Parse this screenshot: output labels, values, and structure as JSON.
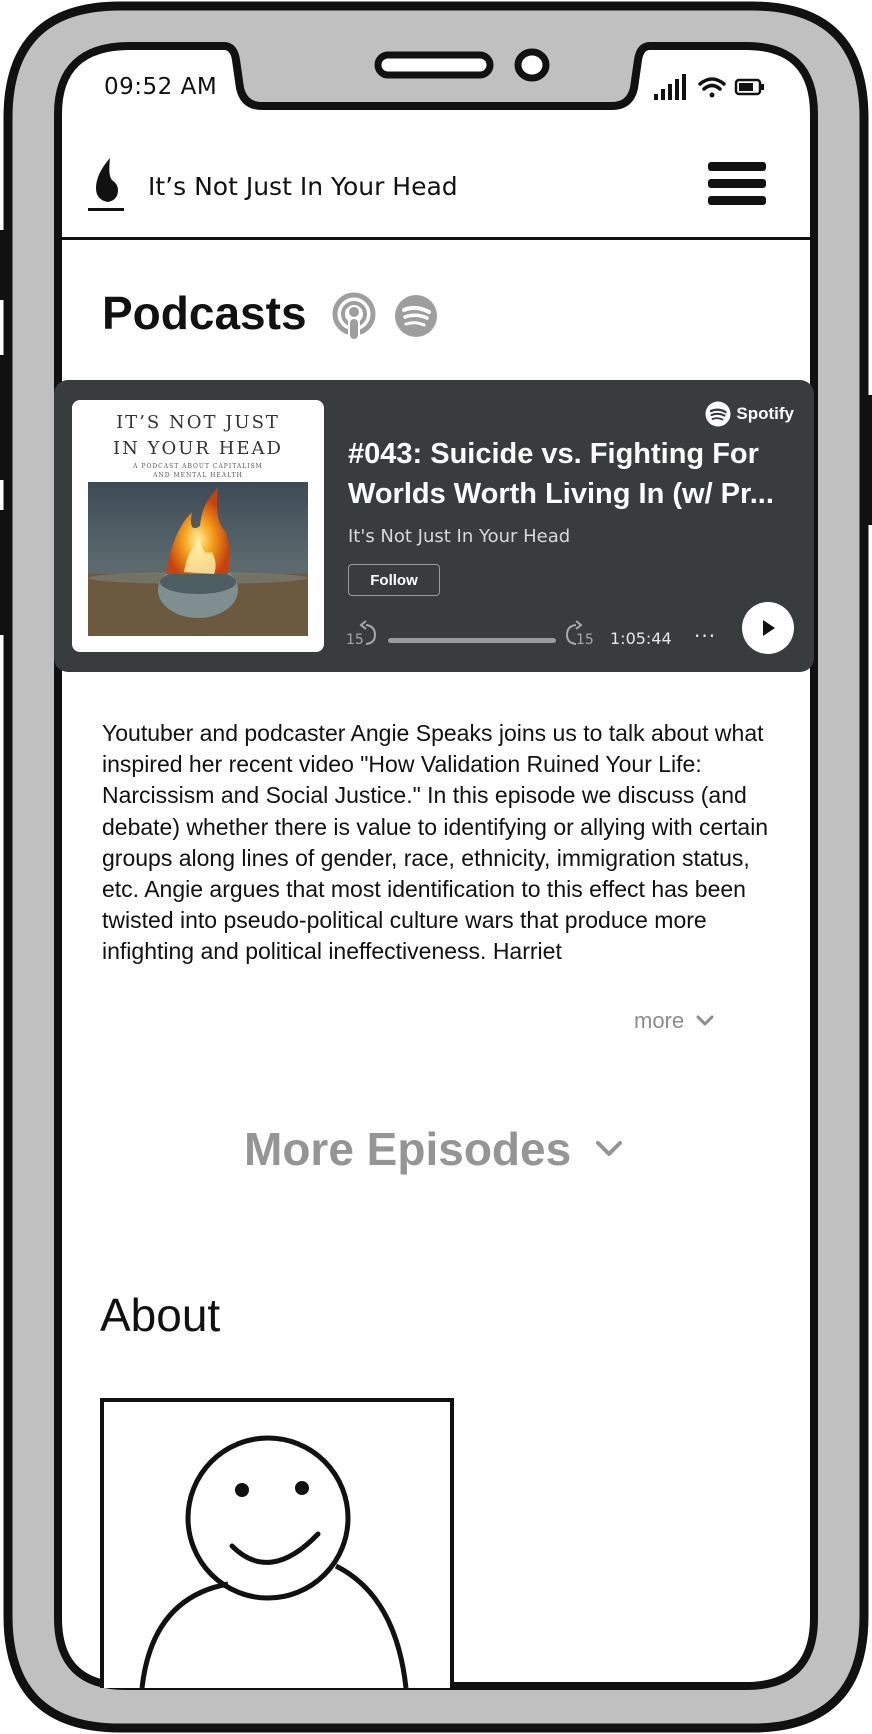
{
  "status_bar": {
    "time": "09:52 AM",
    "icons": [
      "signal-icon",
      "wifi-icon",
      "battery-icon"
    ]
  },
  "header": {
    "title": "It’s Not Just In Your Head",
    "logo_icon": "flame-logo-icon",
    "menu_icon": "hamburger-menu-icon"
  },
  "podcasts": {
    "heading": "Podcasts",
    "platform_icons": [
      "apple-podcasts-icon",
      "spotify-icon"
    ]
  },
  "embed": {
    "brand": "Spotify",
    "cover": {
      "title_line1": "IT’S NOT JUST",
      "title_line2": "IN YOUR HEAD",
      "subtitle_line1": "A PODCAST ABOUT CAPITALISM",
      "subtitle_line2": "AND MENTAL HEALTH"
    },
    "episode_title_line1": "#043: Suicide vs. Fighting For",
    "episode_title_line2": "Worlds Worth Living In (w/ Pr...",
    "show_name": "It's Not Just In Your Head",
    "follow_label": "Follow",
    "skip_back_label": "15",
    "skip_forward_label": "15",
    "duration": "1:05:44",
    "more_options_label": "···",
    "progress": 0,
    "colors": {
      "card_background": "#383c3c",
      "text": "#ffffff"
    }
  },
  "description": {
    "text": "Youtuber and podcaster Angie Speaks joins us to talk about what inspired her recent video \"How Validation Ruined Your Life: Narcissism and Social Justice.\"  In this episode we discuss (and debate) whether there is value to identifying or allying with certain groups along lines of gender, race, ethnicity, immigration status, etc. Angie argues that most  identification to this effect has been twisted into pseudo-political culture wars that produce more infighting and political ineffectiveness. Harriet",
    "more_label": "more"
  },
  "more_episodes": {
    "label": "More Episodes"
  },
  "about": {
    "heading": "About",
    "avatar_icon": "avatar-placeholder-icon"
  }
}
